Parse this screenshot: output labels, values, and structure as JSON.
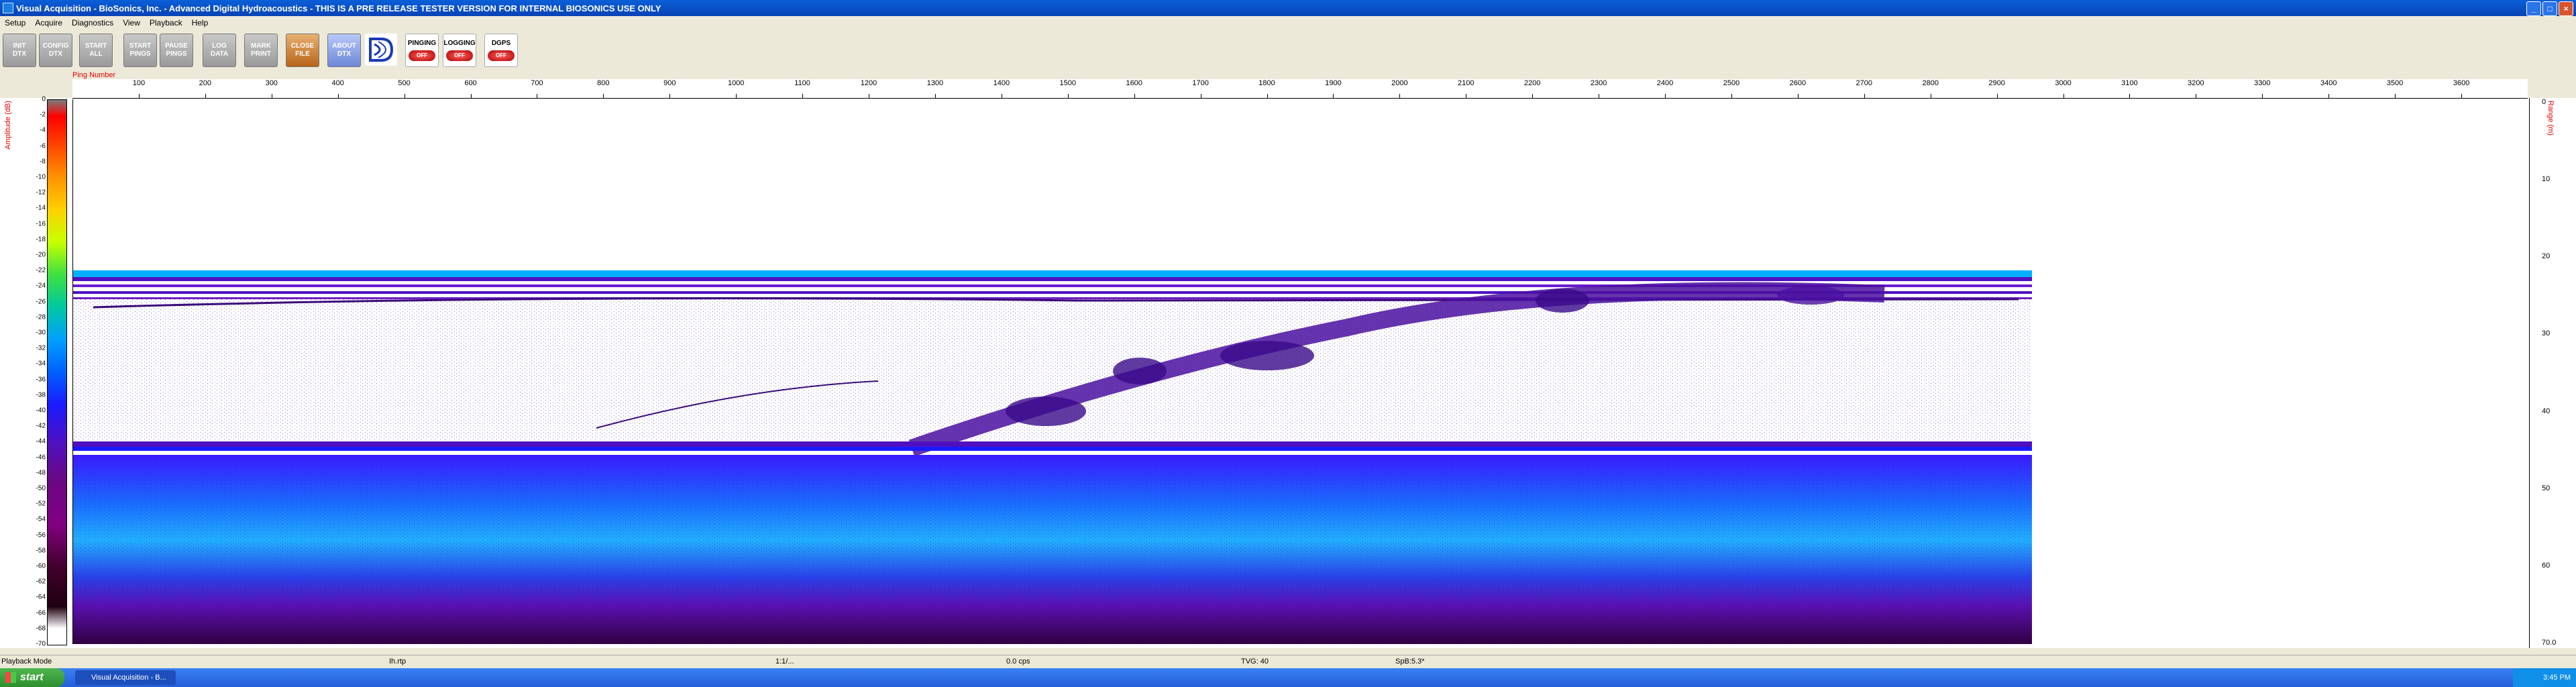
{
  "window": {
    "title": "Visual Acquisition  -  BioSonics, Inc.  -  Advanced Digital Hydroacoustics  -  THIS IS A PRE RELEASE TESTER VERSION FOR INTERNAL BIOSONICS USE ONLY"
  },
  "menu": [
    "Setup",
    "Acquire",
    "Diagnostics",
    "View",
    "Playback",
    "Help"
  ],
  "toolbar": [
    {
      "label": "INIT\nDTX",
      "style": "gray"
    },
    {
      "label": "CONFIG\nDTX",
      "style": "gray"
    },
    {
      "label": "START\nALL",
      "style": "gray"
    },
    {
      "label": "START\nPINGS",
      "style": "gray"
    },
    {
      "label": "PAUSE\nPINGS",
      "style": "gray"
    },
    {
      "label": "LOG\nDATA",
      "style": "gray"
    },
    {
      "label": "MARK\nPRINT",
      "style": "gray"
    },
    {
      "label": "CLOSE\nFILE",
      "style": "orange"
    },
    {
      "label": "ABOUT\nDTX",
      "style": "blue"
    }
  ],
  "indicators": [
    {
      "label": "PINGING",
      "state": "OFF"
    },
    {
      "label": "LOGGING",
      "state": "OFF"
    },
    {
      "label": "DGPS",
      "state": "OFF"
    }
  ],
  "echogram": {
    "ping_axis_label": "Ping Number",
    "ping_ticks": [
      100,
      200,
      300,
      400,
      500,
      600,
      700,
      800,
      900,
      1000,
      1100,
      1200,
      1300,
      1400,
      1500,
      1600,
      1700,
      1800,
      1900,
      2000,
      2100,
      2200,
      2300,
      2400,
      2500,
      2600,
      2700,
      2800,
      2900,
      3000,
      3100,
      3200,
      3300,
      3400,
      3500,
      3600
    ],
    "amp_label": "Amplitude (dB)",
    "amp_ticks": [
      "0",
      "-2",
      "-4",
      "-6",
      "-8",
      "-10",
      "-12",
      "-14",
      "-16",
      "-18",
      "-20",
      "-22",
      "-24",
      "-26",
      "-28",
      "-30",
      "-32",
      "-34",
      "-36",
      "-38",
      "-40",
      "-42",
      "-44",
      "-46",
      "-48",
      "-50",
      "-52",
      "-54",
      "-56",
      "-58",
      "-60",
      "-62",
      "-64",
      "-66",
      "-68",
      "-70"
    ],
    "range_label": "Range (m)",
    "range_ticks": [
      "0",
      "10",
      "20",
      "30",
      "40",
      "50",
      "60",
      "70.0"
    ]
  },
  "status": {
    "mode": "Playback Mode",
    "ping_rate": "Ih.rtp",
    "frame": "1:1/...",
    "rate": "0.0 cps",
    "tvg": "TVG: 40",
    "spb": "SpB:5.3*"
  },
  "taskbar": {
    "start": "start",
    "task": "Visual Acquisition  -  B...",
    "clock": "3:45 PM"
  },
  "colors": {
    "title_blue": "#0a5fd8",
    "echo_purple": "#5010c0",
    "echo_cyan": "#00a0ff"
  }
}
